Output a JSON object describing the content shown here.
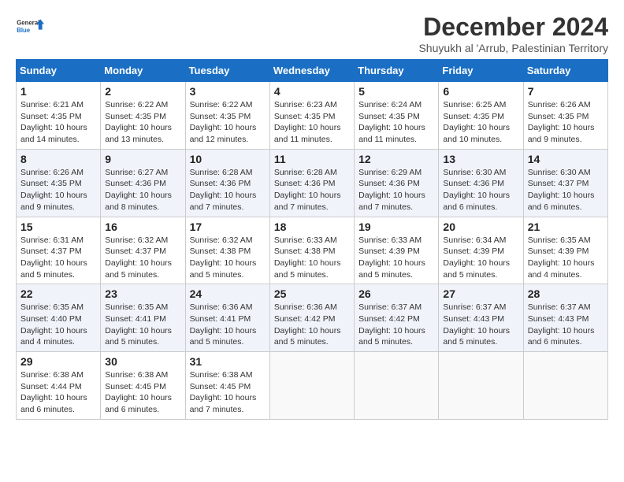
{
  "logo": {
    "line1": "General",
    "line2": "Blue"
  },
  "title": "December 2024",
  "location": "Shuyukh al 'Arrub, Palestinian Territory",
  "weekdays": [
    "Sunday",
    "Monday",
    "Tuesday",
    "Wednesday",
    "Thursday",
    "Friday",
    "Saturday"
  ],
  "weeks": [
    [
      {
        "day": "1",
        "info": "Sunrise: 6:21 AM\nSunset: 4:35 PM\nDaylight: 10 hours\nand 14 minutes."
      },
      {
        "day": "2",
        "info": "Sunrise: 6:22 AM\nSunset: 4:35 PM\nDaylight: 10 hours\nand 13 minutes."
      },
      {
        "day": "3",
        "info": "Sunrise: 6:22 AM\nSunset: 4:35 PM\nDaylight: 10 hours\nand 12 minutes."
      },
      {
        "day": "4",
        "info": "Sunrise: 6:23 AM\nSunset: 4:35 PM\nDaylight: 10 hours\nand 11 minutes."
      },
      {
        "day": "5",
        "info": "Sunrise: 6:24 AM\nSunset: 4:35 PM\nDaylight: 10 hours\nand 11 minutes."
      },
      {
        "day": "6",
        "info": "Sunrise: 6:25 AM\nSunset: 4:35 PM\nDaylight: 10 hours\nand 10 minutes."
      },
      {
        "day": "7",
        "info": "Sunrise: 6:26 AM\nSunset: 4:35 PM\nDaylight: 10 hours\nand 9 minutes."
      }
    ],
    [
      {
        "day": "8",
        "info": "Sunrise: 6:26 AM\nSunset: 4:35 PM\nDaylight: 10 hours\nand 9 minutes."
      },
      {
        "day": "9",
        "info": "Sunrise: 6:27 AM\nSunset: 4:36 PM\nDaylight: 10 hours\nand 8 minutes."
      },
      {
        "day": "10",
        "info": "Sunrise: 6:28 AM\nSunset: 4:36 PM\nDaylight: 10 hours\nand 7 minutes."
      },
      {
        "day": "11",
        "info": "Sunrise: 6:28 AM\nSunset: 4:36 PM\nDaylight: 10 hours\nand 7 minutes."
      },
      {
        "day": "12",
        "info": "Sunrise: 6:29 AM\nSunset: 4:36 PM\nDaylight: 10 hours\nand 7 minutes."
      },
      {
        "day": "13",
        "info": "Sunrise: 6:30 AM\nSunset: 4:36 PM\nDaylight: 10 hours\nand 6 minutes."
      },
      {
        "day": "14",
        "info": "Sunrise: 6:30 AM\nSunset: 4:37 PM\nDaylight: 10 hours\nand 6 minutes."
      }
    ],
    [
      {
        "day": "15",
        "info": "Sunrise: 6:31 AM\nSunset: 4:37 PM\nDaylight: 10 hours\nand 5 minutes."
      },
      {
        "day": "16",
        "info": "Sunrise: 6:32 AM\nSunset: 4:37 PM\nDaylight: 10 hours\nand 5 minutes."
      },
      {
        "day": "17",
        "info": "Sunrise: 6:32 AM\nSunset: 4:38 PM\nDaylight: 10 hours\nand 5 minutes."
      },
      {
        "day": "18",
        "info": "Sunrise: 6:33 AM\nSunset: 4:38 PM\nDaylight: 10 hours\nand 5 minutes."
      },
      {
        "day": "19",
        "info": "Sunrise: 6:33 AM\nSunset: 4:39 PM\nDaylight: 10 hours\nand 5 minutes."
      },
      {
        "day": "20",
        "info": "Sunrise: 6:34 AM\nSunset: 4:39 PM\nDaylight: 10 hours\nand 5 minutes."
      },
      {
        "day": "21",
        "info": "Sunrise: 6:35 AM\nSunset: 4:39 PM\nDaylight: 10 hours\nand 4 minutes."
      }
    ],
    [
      {
        "day": "22",
        "info": "Sunrise: 6:35 AM\nSunset: 4:40 PM\nDaylight: 10 hours\nand 4 minutes."
      },
      {
        "day": "23",
        "info": "Sunrise: 6:35 AM\nSunset: 4:41 PM\nDaylight: 10 hours\nand 5 minutes."
      },
      {
        "day": "24",
        "info": "Sunrise: 6:36 AM\nSunset: 4:41 PM\nDaylight: 10 hours\nand 5 minutes."
      },
      {
        "day": "25",
        "info": "Sunrise: 6:36 AM\nSunset: 4:42 PM\nDaylight: 10 hours\nand 5 minutes."
      },
      {
        "day": "26",
        "info": "Sunrise: 6:37 AM\nSunset: 4:42 PM\nDaylight: 10 hours\nand 5 minutes."
      },
      {
        "day": "27",
        "info": "Sunrise: 6:37 AM\nSunset: 4:43 PM\nDaylight: 10 hours\nand 5 minutes."
      },
      {
        "day": "28",
        "info": "Sunrise: 6:37 AM\nSunset: 4:43 PM\nDaylight: 10 hours\nand 6 minutes."
      }
    ],
    [
      {
        "day": "29",
        "info": "Sunrise: 6:38 AM\nSunset: 4:44 PM\nDaylight: 10 hours\nand 6 minutes."
      },
      {
        "day": "30",
        "info": "Sunrise: 6:38 AM\nSunset: 4:45 PM\nDaylight: 10 hours\nand 6 minutes."
      },
      {
        "day": "31",
        "info": "Sunrise: 6:38 AM\nSunset: 4:45 PM\nDaylight: 10 hours\nand 7 minutes."
      },
      null,
      null,
      null,
      null
    ]
  ]
}
